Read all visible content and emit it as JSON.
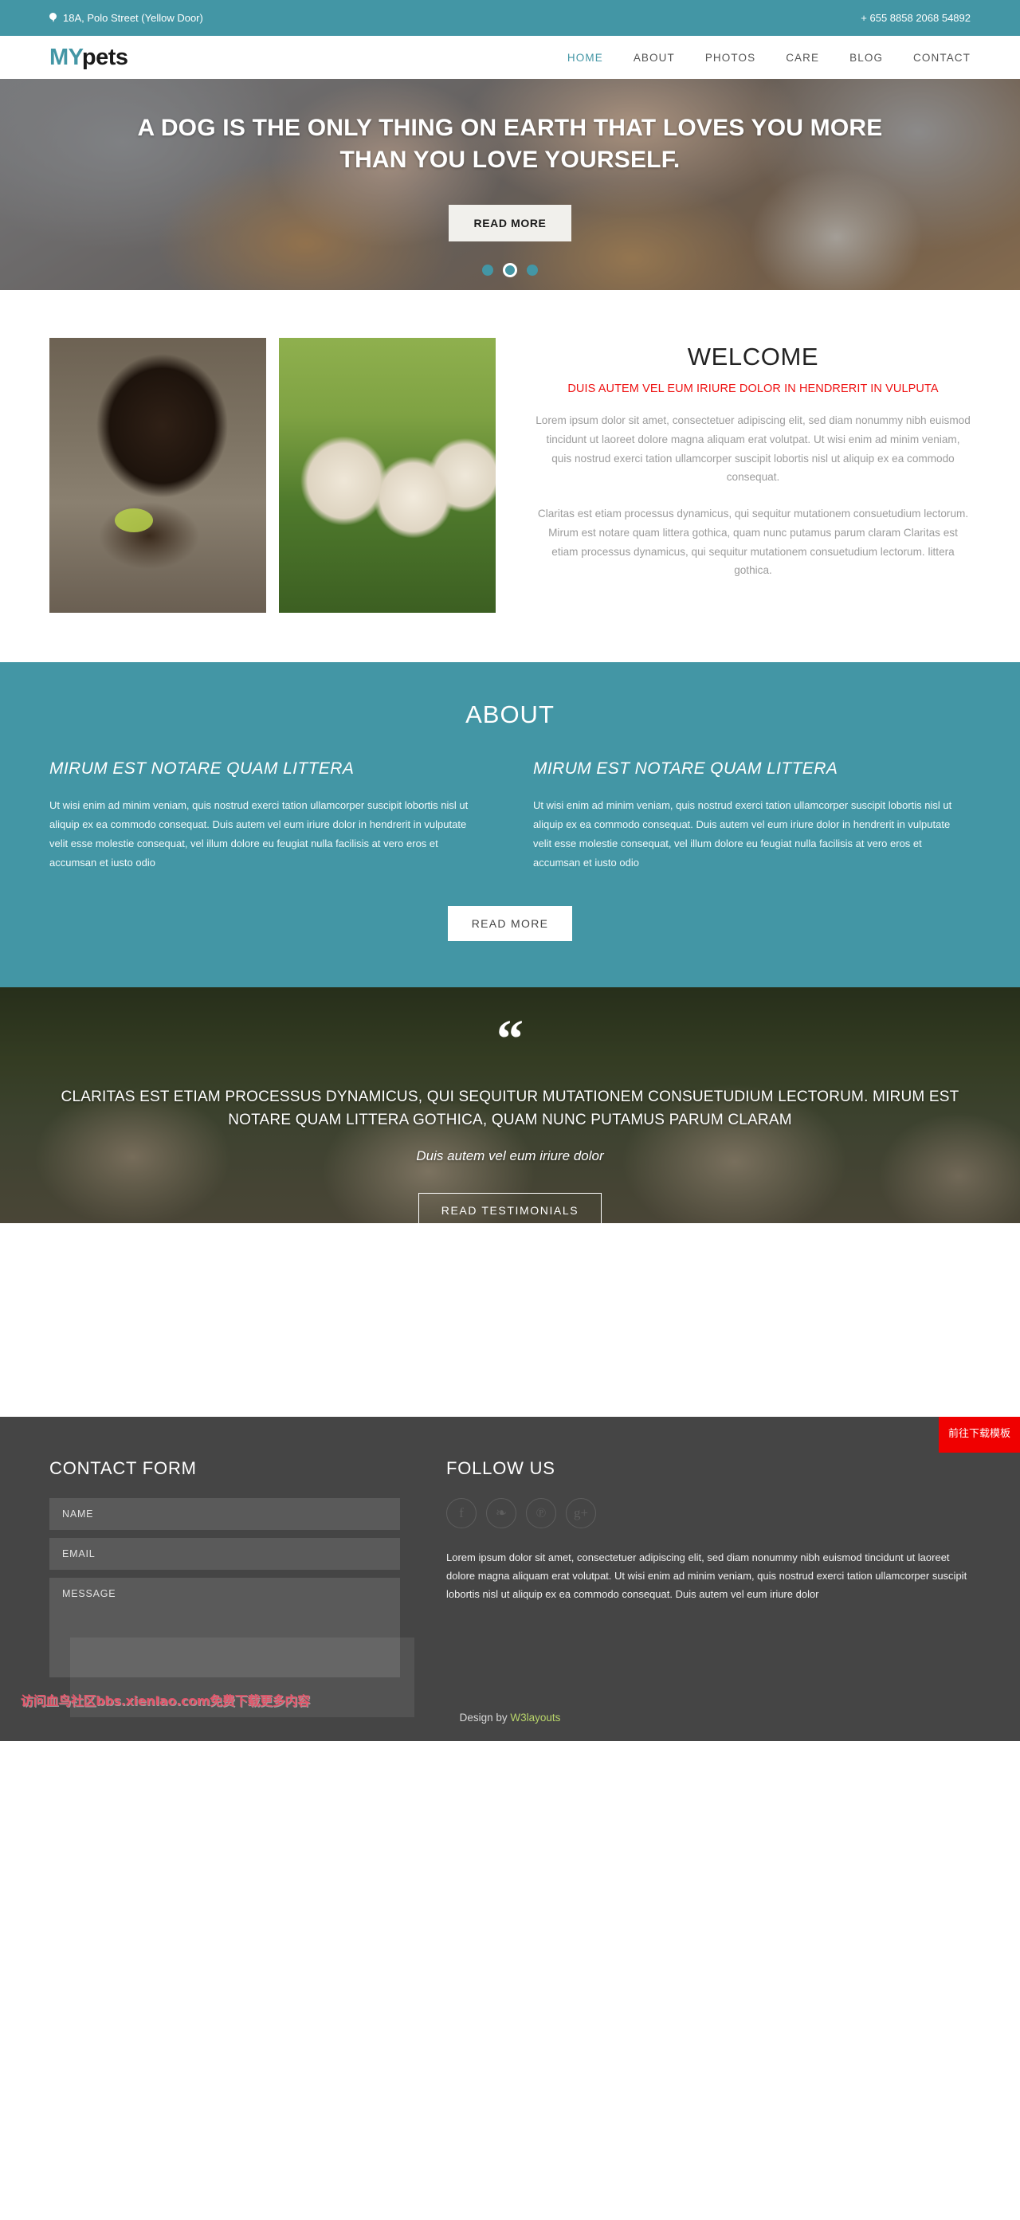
{
  "topbar": {
    "address": "18A, Polo Street (Yellow Door)",
    "phone": "+ 655 8858 2068 54892",
    "pin_icon": "map-pin-icon"
  },
  "header": {
    "logo_my": "MY",
    "logo_pets": "pets",
    "nav": [
      {
        "label": "HOME",
        "active": true
      },
      {
        "label": "ABOUT",
        "active": false
      },
      {
        "label": "PHOTOS",
        "active": false
      },
      {
        "label": "CARE",
        "active": false
      },
      {
        "label": "BLOG",
        "active": false
      },
      {
        "label": "CONTACT",
        "active": false
      }
    ]
  },
  "hero": {
    "headline": "A DOG IS THE ONLY THING ON EARTH THAT LOVES YOU MORE THAN YOU LOVE YOURSELF.",
    "button": "READ MORE",
    "slides": 3,
    "active_slide": 2
  },
  "welcome": {
    "title": "WELCOME",
    "subtitle": "DUIS AUTEM VEL EUM IRIURE DOLOR IN HENDRERIT IN VULPUTA",
    "paragraph_1": "Lorem ipsum dolor sit amet, consectetuer adipiscing elit, sed diam nonummy nibh euismod tincidunt ut laoreet dolore magna aliquam erat volutpat. Ut wisi enim ad minim veniam, quis nostrud exerci tation ullamcorper suscipit lobortis nisl ut aliquip ex ea commodo consequat.",
    "paragraph_2": "Claritas est etiam processus dynamicus, qui sequitur mutationem consuetudium lectorum. Mirum est notare quam littera gothica, quam nunc putamus parum claram Claritas est etiam processus dynamicus, qui sequitur mutationem consuetudium lectorum. littera gothica.",
    "image_1_alt": "chocolate-labrador-puppy-photo",
    "image_2_alt": "white-labrador-puppies-photo"
  },
  "about": {
    "title": "ABOUT",
    "columns": [
      {
        "heading": "MIRUM EST NOTARE QUAM LITTERA",
        "text": "Ut wisi enim ad minim veniam, quis nostrud exerci tation ullamcorper suscipit lobortis nisl ut aliquip ex ea commodo consequat. Duis autem vel eum iriure dolor in hendrerit in vulputate velit esse molestie consequat, vel illum dolore eu feugiat nulla facilisis at vero eros et accumsan et iusto odio"
      },
      {
        "heading": "MIRUM EST NOTARE QUAM LITTERA",
        "text": "Ut wisi enim ad minim veniam, quis nostrud exerci tation ullamcorper suscipit lobortis nisl ut aliquip ex ea commodo consequat. Duis autem vel eum iriure dolor in hendrerit in vulputate velit esse molestie consequat, vel illum dolore eu feugiat nulla facilisis at vero eros et accumsan et iusto odio"
      }
    ],
    "button": "READ MORE"
  },
  "testimonial": {
    "quote_icon": "“",
    "quote": "CLARITAS EST ETIAM PROCESSUS DYNAMICUS, QUI SEQUITUR MUTATIONEM CONSUETUDIUM LECTORUM. MIRUM EST NOTARE QUAM LITTERA GOTHICA, QUAM NUNC PUTAMUS PARUM CLARAM",
    "author": "Duis autem vel eum iriure dolor",
    "button": "READ TESTIMONIALS",
    "image_alt": "three-labrador-puppies-in-grass-photo"
  },
  "footer": {
    "contact_title": "CONTACT FORM",
    "follow_title": "FOLLOW US",
    "fields": {
      "name_placeholder": "NAME",
      "name_value": "",
      "email_placeholder": "EMAIL",
      "email_value": "",
      "message_placeholder": "MESSAGE",
      "message_value": ""
    },
    "socials": [
      {
        "name": "facebook-icon",
        "glyph": "f"
      },
      {
        "name": "twitter-icon",
        "glyph": "❧"
      },
      {
        "name": "pinterest-icon",
        "glyph": "℗"
      },
      {
        "name": "googleplus-icon",
        "glyph": "g+"
      }
    ],
    "follow_text": "Lorem ipsum dolor sit amet, consectetuer adipiscing elit, sed diam nonummy nibh euismod tincidunt ut laoreet dolore magna aliquam erat volutpat. Ut wisi enim ad minim veniam, quis nostrud exerci tation ullamcorper suscipit lobortis nisl ut aliquip ex ea commodo consequat. Duis autem vel eum iriure dolor",
    "design_by": "Design by",
    "design_link": "W3layouts"
  },
  "overlays": {
    "watermark": "访问血鸟社区bbs.xienIao.com免费下载更多内容",
    "download_button": "前往下载模板"
  },
  "colors": {
    "accent": "#4396a5",
    "alert": "#ee1111",
    "footer_bg": "#454545",
    "download_btn": "#f00000"
  }
}
